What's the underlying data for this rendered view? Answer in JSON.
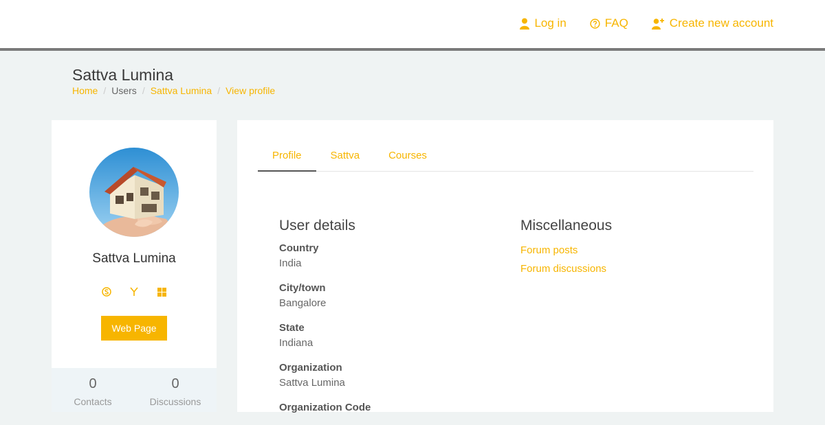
{
  "header": {
    "nav": [
      {
        "label": "Log in",
        "icon": "user-icon"
      },
      {
        "label": "FAQ",
        "icon": "question-circle-icon"
      },
      {
        "label": "Create new account",
        "icon": "user-plus-icon"
      }
    ]
  },
  "page": {
    "title": "Sattva Lumina",
    "breadcrumb": [
      "Home",
      "Users",
      "Sattva Lumina",
      "View profile"
    ]
  },
  "profile_card": {
    "name": "Sattva Lumina",
    "socials": [
      "skype-icon",
      "yahoo-icon",
      "windows-icon"
    ],
    "web_button": "Web Page",
    "stats": [
      {
        "value": "0",
        "label": "Contacts"
      },
      {
        "value": "0",
        "label": "Discussions"
      }
    ]
  },
  "tabs": [
    "Profile",
    "Sattva",
    "Courses"
  ],
  "user_details": {
    "heading": "User details",
    "fields": [
      {
        "label": "Country",
        "value": "India"
      },
      {
        "label": "City/town",
        "value": "Bangalore"
      },
      {
        "label": "State",
        "value": "Indiana"
      },
      {
        "label": "Organization",
        "value": "Sattva Lumina"
      },
      {
        "label": "Organization Code",
        "value": ""
      }
    ]
  },
  "misc": {
    "heading": "Miscellaneous",
    "links": [
      "Forum posts",
      "Forum discussions"
    ]
  },
  "colors": {
    "accent": "#f7b500",
    "background": "#eff3f3"
  }
}
